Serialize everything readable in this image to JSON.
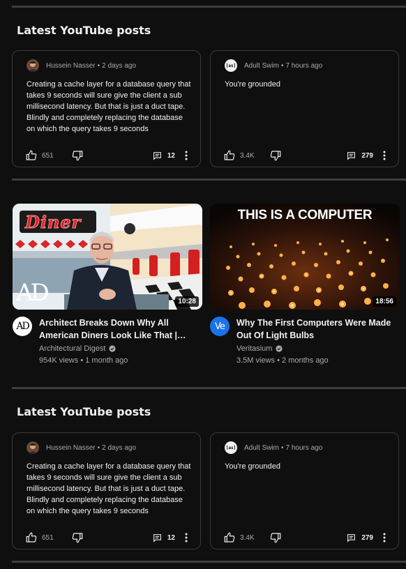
{
  "sections": {
    "posts_top_title": "Latest YouTube posts",
    "posts_bottom_title": "Latest YouTube posts"
  },
  "posts": [
    {
      "author": "Hussein Nasser",
      "age": "2 days ago",
      "text": "Creating a cache layer for a database query that takes 9 seconds will sure give the client a sub millisecond latency. But that is just a duct tape. Blindly and completely replacing the database on which the query takes 9 seconds",
      "likes": "651",
      "comments": "12",
      "avatar": "person-avatar"
    },
    {
      "author": "Adult Swim",
      "age": "7 hours ago",
      "text": "You're grounded",
      "likes": "3.4K",
      "comments": "279",
      "avatar_text": "[as]"
    }
  ],
  "videos": [
    {
      "title": "Architect Breaks Down Why All American Diners Look Like That | Architectural Digest",
      "channel": "Architectural Digest",
      "views": "954K views",
      "age": "1 month ago",
      "duration": "10:28",
      "avatar_text": "AD",
      "thumb_logo": "AD",
      "thumb_sign": "Diner"
    },
    {
      "title": "Why The First Computers Were Made Out Of Light Bulbs",
      "channel": "Veritasium",
      "views": "3.5M views",
      "age": "2 months ago",
      "duration": "18:56",
      "avatar_text": "Ve",
      "thumb_caption": "THIS IS A COMPUTER"
    }
  ],
  "separator": "•",
  "colors": {
    "background": "#0f0f0f",
    "divider": "#3f3f3f",
    "card_border": "#3a3a3a",
    "secondary_text": "#aaaaaa",
    "veritasium_blue": "#1a73e8"
  },
  "icons": [
    "thumb-up-icon",
    "thumb-down-icon",
    "comment-icon",
    "more-vert-icon",
    "verified-icon"
  ]
}
